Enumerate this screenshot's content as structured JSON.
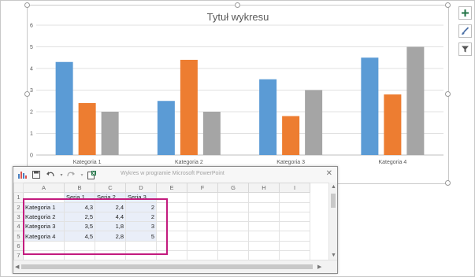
{
  "chart_data": {
    "type": "bar",
    "title": "Tytuł wykresu",
    "categories": [
      "Kategoria 1",
      "Kategoria 2",
      "Kategoria 3",
      "Kategoria 4"
    ],
    "series": [
      {
        "name": "Seria 1",
        "values": [
          4.3,
          2.5,
          3.5,
          4.5
        ],
        "color": "#5b9bd5"
      },
      {
        "name": "Seria 2",
        "values": [
          2.4,
          4.4,
          1.8,
          2.8
        ],
        "color": "#ed7d31"
      },
      {
        "name": "Seria 3",
        "values": [
          2,
          2,
          3,
          5
        ],
        "color": "#a5a5a5"
      }
    ],
    "ylim": [
      0,
      6
    ],
    "yticks": [
      "0",
      "1",
      "2",
      "3",
      "4",
      "5",
      "6"
    ],
    "grid": true,
    "legend": "none"
  },
  "side_buttons": [
    {
      "icon": "plus-icon",
      "color": "#217346"
    },
    {
      "icon": "brush-icon",
      "color": "#4a6fa5"
    },
    {
      "icon": "filter-icon",
      "color": "#555555"
    }
  ],
  "sheet": {
    "title": "Wykres w programie Microsoft PowerPoint",
    "close": "✕",
    "columns": [
      "A",
      "B",
      "C",
      "D",
      "E",
      "F",
      "G",
      "H",
      "I"
    ],
    "rows": [
      {
        "num": "1",
        "cells": [
          "",
          "Seria 1",
          "Seria 2",
          "Seria 3",
          "",
          "",
          "",
          "",
          ""
        ]
      },
      {
        "num": "2",
        "cells": [
          "Kategoria 1",
          "4,3",
          "2,4",
          "2",
          "",
          "",
          "",
          "",
          ""
        ]
      },
      {
        "num": "3",
        "cells": [
          "Kategoria 2",
          "2,5",
          "4,4",
          "2",
          "",
          "",
          "",
          "",
          ""
        ]
      },
      {
        "num": "4",
        "cells": [
          "Kategoria 3",
          "3,5",
          "1,8",
          "3",
          "",
          "",
          "",
          "",
          ""
        ]
      },
      {
        "num": "5",
        "cells": [
          "Kategoria 4",
          "4,5",
          "2,8",
          "5",
          "",
          "",
          "",
          "",
          ""
        ]
      },
      {
        "num": "6",
        "cells": [
          "",
          "",
          "",
          "",
          "",
          "",
          "",
          "",
          ""
        ]
      },
      {
        "num": "7",
        "cells": [
          "",
          "",
          "",
          "",
          "",
          "",
          "",
          "",
          ""
        ]
      }
    ]
  }
}
